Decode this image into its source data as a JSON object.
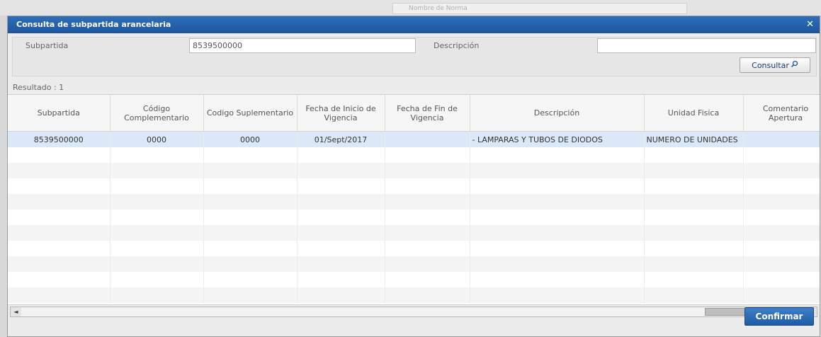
{
  "background": {
    "field_text": "Nombre de Norma"
  },
  "dialog": {
    "title": "Consulta de subpartida arancelaria",
    "close_glyph": "✕",
    "close_icon": "close-icon"
  },
  "form": {
    "subpartida_label": "Subpartida",
    "subpartida_value": "8539500000",
    "descripcion_label": "Descripción",
    "descripcion_value": "",
    "consultar_label": "Consultar",
    "consultar_icon": "search-icon"
  },
  "resultado": "Resultado : 1",
  "grid": {
    "headers": [
      "Subpartida",
      "Código Complementario",
      "Codigo Suplementario",
      "Fecha de Inicio de Vigencia",
      "Fecha de Fin de Vigencia",
      "Descripción",
      "Unidad Fisica",
      "Comentario Apertura"
    ],
    "rows": [
      [
        "8539500000",
        "0000",
        "0000",
        "01/Sept/2017",
        "",
        "- LAMPARAS Y TUBOS DE DIODOS",
        "NUMERO DE UNIDADES",
        ""
      ]
    ]
  },
  "scrollbar": {
    "left_arrow": "◄",
    "right_arrow": "►"
  },
  "footer": {
    "confirmar_label": "Confirmar"
  },
  "colors": {
    "titlebar": "#1d56a0",
    "selected_row": "#dbe8f7",
    "confirm_button": "#2a69b3"
  }
}
